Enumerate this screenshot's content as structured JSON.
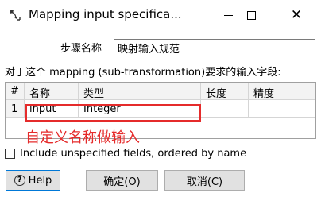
{
  "window": {
    "title": "Mapping input specifica...",
    "close_glyph": "✕"
  },
  "form": {
    "step_label": "步骤名称",
    "step_value": "映射输入规范",
    "description": "对于这个 mapping (sub-transformation)要求的输入字段:"
  },
  "grid": {
    "headers": {
      "num": "#",
      "name": "名称",
      "type": "类型",
      "length": "长度",
      "precision": "精度"
    },
    "rows": [
      {
        "num": "1",
        "name": "input",
        "type": "Integer",
        "length": "",
        "precision": ""
      }
    ]
  },
  "annotation": {
    "text": "自定义名称做输入",
    "color": "#e52b2b"
  },
  "include_unspecified": {
    "label": "Include unspecified fields, ordered by name",
    "checked": false
  },
  "buttons": {
    "help_icon": "?",
    "help": "Help",
    "ok": "确定(O)",
    "cancel": "取消(C)"
  }
}
